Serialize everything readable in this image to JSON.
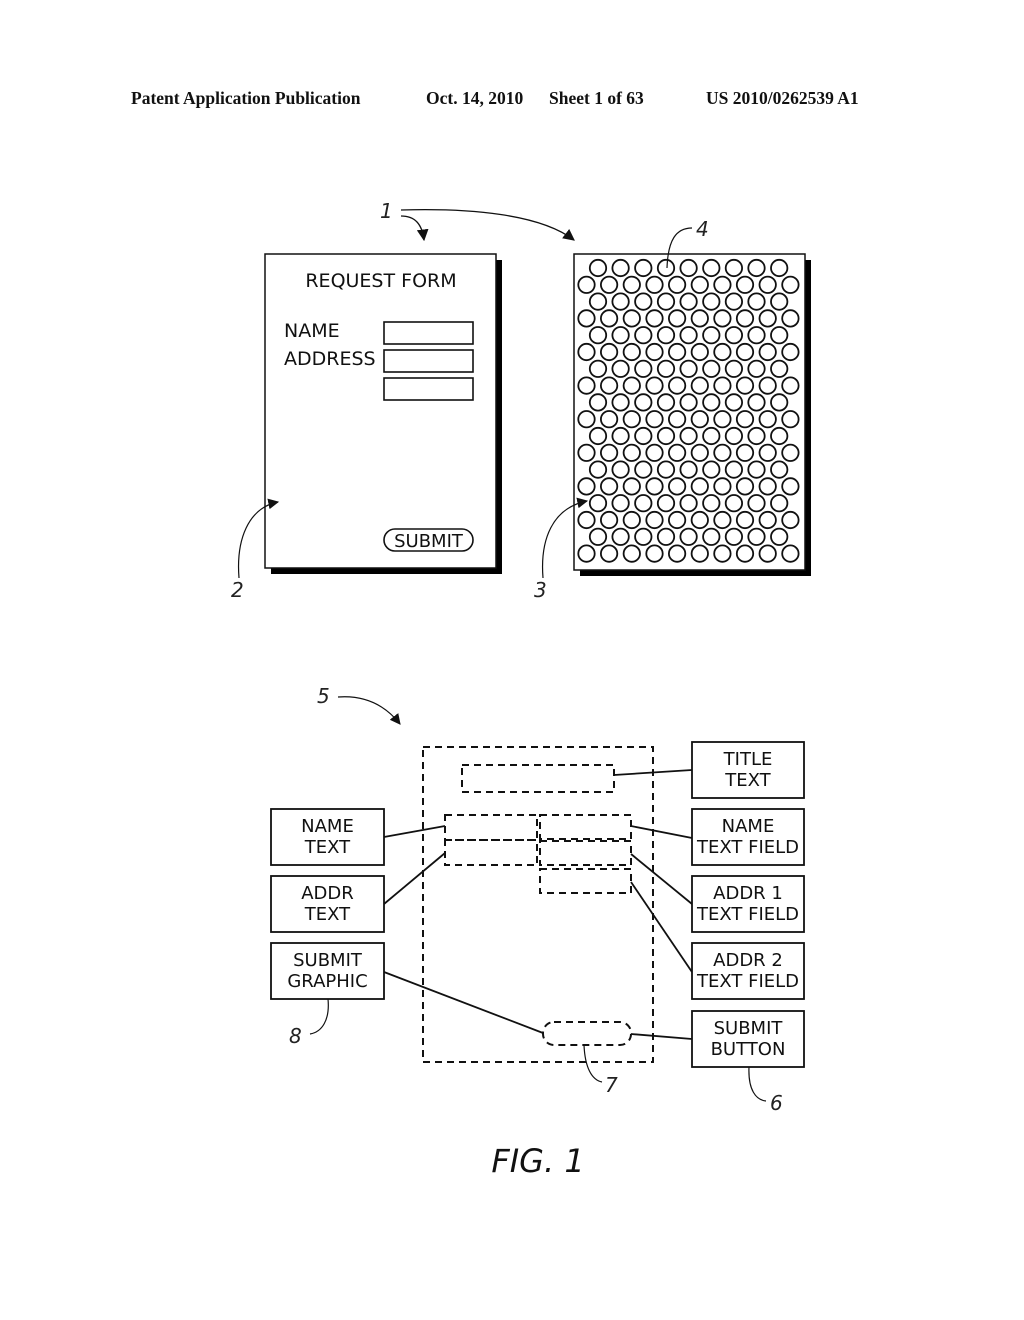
{
  "header": {
    "publication": "Patent Application Publication",
    "date": "Oct. 14, 2010",
    "sheet": "Sheet 1 of 63",
    "number": "US 2010/0262539 A1"
  },
  "figure": {
    "caption": "FIG. 1",
    "reference_numerals": {
      "forms": "1",
      "printed_form": "2",
      "tag_layer": "3",
      "tag": "4",
      "form_description": "5",
      "submit_button": "6",
      "submit_zone": "7",
      "submit_graphic": "8"
    },
    "request_form": {
      "title": "REQUEST FORM",
      "labels": [
        "NAME",
        "ADDRESS"
      ],
      "text_field_count": 3,
      "button": "SUBMIT"
    },
    "tag_grid": {
      "rows": 18,
      "odd_row_count": 9,
      "even_row_count": 10
    },
    "left_boxes": [
      {
        "line1": "NAME",
        "line2": "TEXT"
      },
      {
        "line1": "ADDR",
        "line2": "TEXT"
      },
      {
        "line1": "SUBMIT",
        "line2": "GRAPHIC"
      }
    ],
    "right_boxes": [
      {
        "line1": "TITLE",
        "line2": "TEXT"
      },
      {
        "line1": "NAME",
        "line2": "TEXT FIELD"
      },
      {
        "line1": "ADDR 1",
        "line2": "TEXT FIELD"
      },
      {
        "line1": "ADDR 2",
        "line2": "TEXT FIELD"
      },
      {
        "line1": "SUBMIT",
        "line2": "BUTTON"
      }
    ]
  }
}
